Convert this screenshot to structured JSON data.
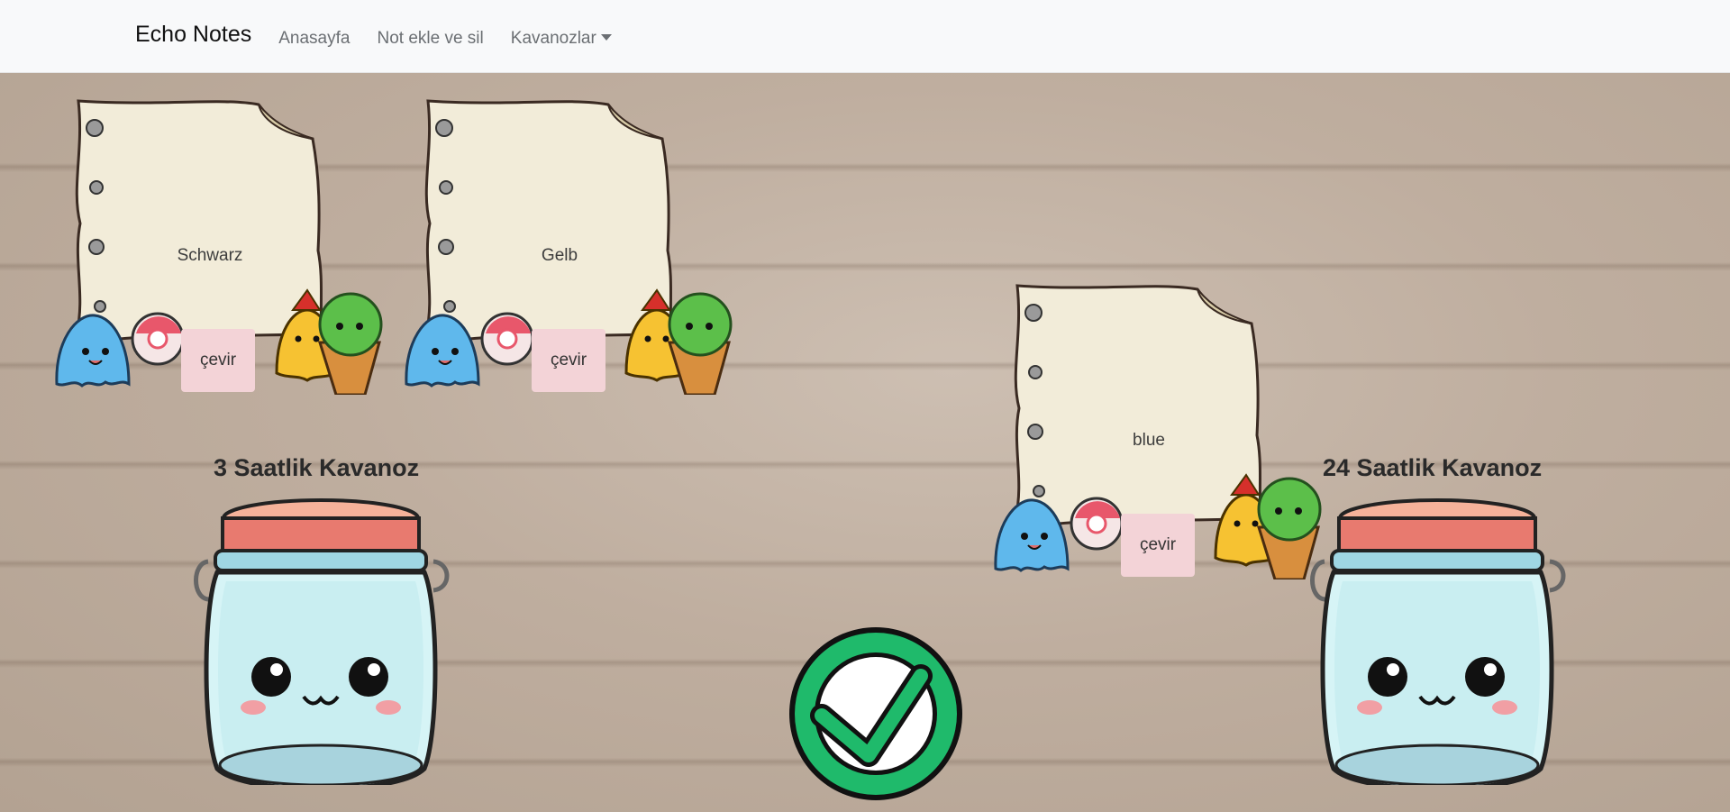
{
  "nav": {
    "brand": "Echo Notes",
    "links": [
      "Anasayfa",
      "Not ekle ve sil",
      "Kavanozlar"
    ]
  },
  "notes": [
    {
      "text": "Schwarz",
      "button": "çevir"
    },
    {
      "text": "Gelb",
      "button": "çevir"
    },
    {
      "text": "blue",
      "button": "çevir"
    }
  ],
  "jars": [
    {
      "title": "3 Saatlik Kavanoz"
    },
    {
      "title": "24 Saatlik Kavanoz"
    }
  ],
  "icons": {
    "check": "check-circle-icon",
    "jar": "jar-icon",
    "dropdown": "chevron-down-icon"
  },
  "colors": {
    "check": "#1fba6b",
    "button": "#f3d3d7",
    "navbar": "#f8f9fa"
  }
}
